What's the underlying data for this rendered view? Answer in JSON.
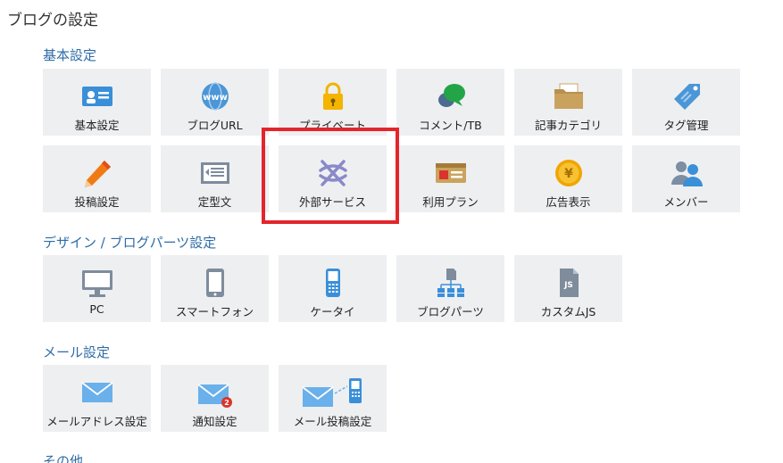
{
  "page": {
    "title": "ブログの設定"
  },
  "sections": {
    "basic": {
      "title": "基本設定",
      "items": [
        {
          "label": "基本設定",
          "icon": "id-card-icon"
        },
        {
          "label": "ブログURL",
          "icon": "www-globe-icon"
        },
        {
          "label": "プライベート",
          "icon": "lock-icon"
        },
        {
          "label": "コメント/TB",
          "icon": "comment-bubble-icon"
        },
        {
          "label": "記事カテゴリ",
          "icon": "folder-icon"
        },
        {
          "label": "タグ管理",
          "icon": "tag-icon"
        },
        {
          "label": "投稿設定",
          "icon": "pencil-icon"
        },
        {
          "label": "定型文",
          "icon": "template-doc-icon"
        },
        {
          "label": "外部サービス",
          "icon": "external-service-icon"
        },
        {
          "label": "利用プラン",
          "icon": "plan-card-icon"
        },
        {
          "label": "広告表示",
          "icon": "yen-coin-icon"
        },
        {
          "label": "メンバー",
          "icon": "members-icon"
        }
      ]
    },
    "design": {
      "title": "デザイン / ブログパーツ設定",
      "items": [
        {
          "label": "PC",
          "icon": "monitor-icon"
        },
        {
          "label": "スマートフォン",
          "icon": "smartphone-icon"
        },
        {
          "label": "ケータイ",
          "icon": "feature-phone-icon"
        },
        {
          "label": "ブログパーツ",
          "icon": "blog-parts-icon"
        },
        {
          "label": "カスタムJS",
          "icon": "js-file-icon"
        }
      ]
    },
    "mail": {
      "title": "メール設定",
      "items": [
        {
          "label": "メールアドレス設定",
          "icon": "envelope-icon"
        },
        {
          "label": "通知設定",
          "icon": "envelope-badge-icon",
          "badge": "2"
        },
        {
          "label": "メール投稿設定",
          "icon": "mail-to-phone-icon"
        }
      ]
    },
    "other": {
      "title": "その他"
    }
  },
  "colors": {
    "section_title": "#2e6ca6",
    "tile_bg": "#eeeff1",
    "highlight_border": "#e2262c"
  }
}
